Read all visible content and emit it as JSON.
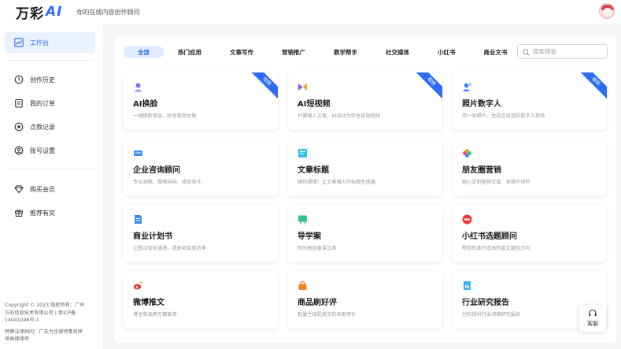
{
  "app": {
    "logo_text": "万彩",
    "logo_ai": "AI",
    "slogan": "你的在线内容创作顾问"
  },
  "sidebar": {
    "items": [
      {
        "label": "工作台",
        "icon": "chart-line-icon"
      },
      {
        "label": "创作历史",
        "icon": "history-icon"
      },
      {
        "label": "我的订单",
        "icon": "clipboard-icon"
      },
      {
        "label": "点数记录",
        "icon": "record-icon"
      },
      {
        "label": "账号设置",
        "icon": "user-circle-icon"
      },
      {
        "label": "购买会员",
        "icon": "diamond-icon"
      },
      {
        "label": "推荐有奖",
        "icon": "gift-icon"
      }
    ],
    "footer": [
      "Copyright © 2023 版权所有：广州",
      "万彩信息技术有限公司 | 粤ICP备",
      "14041046号-1",
      "特聘法律顾问：广东力诠律师事务所",
      "徐高德律师"
    ]
  },
  "tabs": [
    "全部",
    "热门应用",
    "文章写作",
    "营销推广",
    "教学帮手",
    "社交媒体",
    "小红书",
    "商业文书"
  ],
  "search": {
    "placeholder": "搜索模板"
  },
  "cards": [
    {
      "title": "AI换脸",
      "desc": "一键换脸变装，秒变视频主角",
      "badge": "视频",
      "icon": "face-swap-icon",
      "color": "#8a6cf0"
    },
    {
      "title": "AI短视频",
      "desc": "只需输入文案，AI自动为你生成短视频",
      "badge": "视频",
      "icon": "bowtie-icon",
      "color": "#7a5af0"
    },
    {
      "title": "照片数字人",
      "desc": "用一张照片，生成会说话的数字人视频",
      "badge": "视频",
      "icon": "digital-human-icon",
      "color": "#3f7cf6"
    },
    {
      "title": "企业咨询顾问",
      "desc": "专业洞察、策略导向、成就非凡",
      "badge": "",
      "icon": "consult-icon",
      "color": "#3d8ef5"
    },
    {
      "title": "文章标题",
      "desc": "随你選擇！让文章爆火的标题生成器",
      "badge": "",
      "icon": "title-icon",
      "color": "#33c2e8"
    },
    {
      "title": "朋友圈营销",
      "desc": "随心定制营销文案、发圈不词穷",
      "badge": "",
      "icon": "moments-icon",
      "color": "#f4a21b"
    },
    {
      "title": "商业计划书",
      "desc": "让想法轻松落地，提高项目成功率",
      "badge": "",
      "icon": "doc-icon",
      "color": "#3d8ef5"
    },
    {
      "title": "导学案",
      "desc": "你的高效备课工具",
      "badge": "",
      "icon": "board-icon",
      "color": "#2fc28a"
    },
    {
      "title": "小红书选题顾问",
      "desc": "帮你找准打造高热度文案的方向",
      "badge": "",
      "icon": "xiaohongshu-icon",
      "color": "#ee3a3a"
    },
    {
      "title": "微博推文",
      "desc": "博主和品牌方都爱用",
      "badge": "",
      "icon": "weibo-icon",
      "color": "#e8392b"
    },
    {
      "title": "商品刷好评",
      "desc": "批量生成超真实的买家评价",
      "badge": "",
      "icon": "shop-icon",
      "color": "#f2852a"
    },
    {
      "title": "行业研究报告",
      "desc": "为你提供行业洞察研究报告",
      "badge": "",
      "icon": "report-icon",
      "color": "#33b1ee"
    }
  ],
  "kefu": {
    "label": "客服"
  }
}
